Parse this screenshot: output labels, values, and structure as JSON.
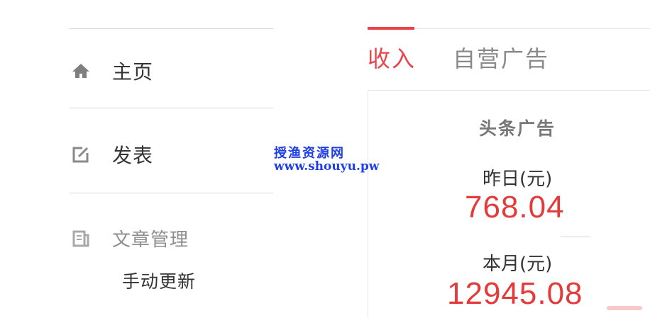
{
  "sidebar": {
    "items": [
      {
        "label": "主页",
        "icon": "home-icon"
      },
      {
        "label": "发表",
        "icon": "edit-icon"
      },
      {
        "label": "文章管理",
        "icon": "article-icon"
      }
    ],
    "sub_item": "手动更新"
  },
  "tabs": [
    {
      "label": "收入",
      "active": true
    },
    {
      "label": "自营广告",
      "active": false
    }
  ],
  "card": {
    "title": "头条广告",
    "yesterday_label": "昨日(元)",
    "yesterday_value": "768.04",
    "month_label": "本月(元)",
    "month_value": "12945.08"
  },
  "watermark": {
    "title": "授渔资源网",
    "url": "www.shouyu.pw"
  },
  "colors": {
    "accent": "#e8444a",
    "value": "#e53a3a",
    "watermark": "#1f3fe6"
  }
}
